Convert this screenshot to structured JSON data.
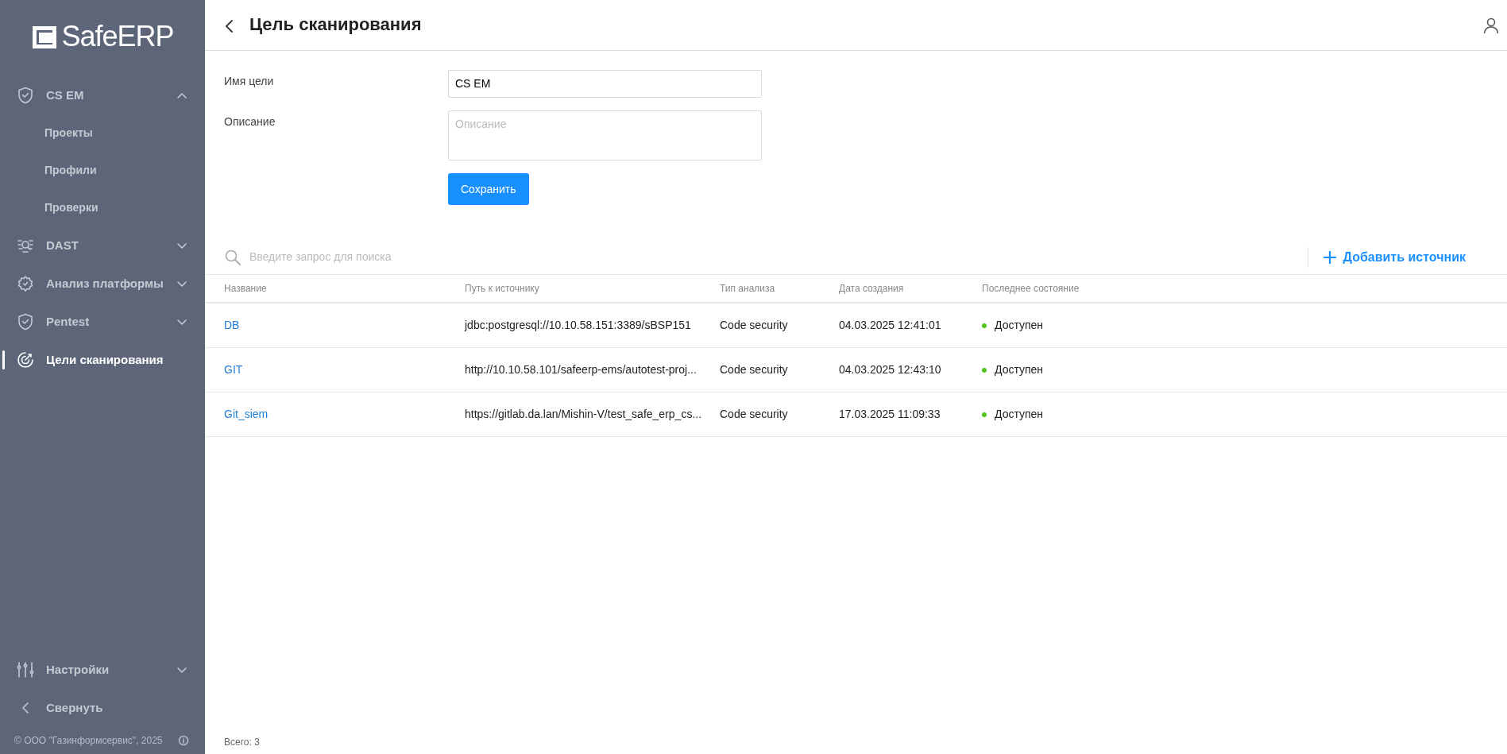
{
  "sidebar": {
    "logo": "Safe**ERP**",
    "items": [
      {
        "label": "CS EM",
        "expanded": true,
        "selected": false,
        "children": [
          {
            "label": "Проекты",
            "selected": false
          },
          {
            "label": "Профили",
            "selected": false
          },
          {
            "label": "Проверки",
            "selected": false
          }
        ]
      },
      {
        "label": "DAST",
        "expanded": false,
        "selected": false
      },
      {
        "label": "Анализ платформы",
        "expanded": false,
        "selected": false
      },
      {
        "label": "Pentest",
        "expanded": false,
        "selected": false
      },
      {
        "label": "Цели сканирования",
        "selected": true
      }
    ],
    "settings": {
      "label": "Настройки",
      "expanded": false
    },
    "collapse": "Свернуть",
    "copyright": "© ООО \"Газинформсервис\", 2025"
  },
  "header": {
    "title": "Цель сканирования"
  },
  "form": {
    "fields": [
      {
        "label": "Имя цели",
        "value": "CS EM",
        "kind": "input"
      },
      {
        "label": "Описание",
        "placeholder": "Описание",
        "kind": "textarea"
      }
    ],
    "save_button": "Сохранить"
  },
  "search": {
    "placeholder": "Введите запрос для поиска"
  },
  "add_button": "Добавить источник",
  "table": {
    "columns": [
      "Название",
      "Путь к источнику",
      "Тип анализа",
      "Дата создания",
      "Последнее состояние"
    ],
    "rows": [
      {
        "name": "DB",
        "path": "jdbc:postgresql://10.10.58.151:3389/sBSP151",
        "type": "Code security",
        "date": "04.03.2025 12:41:01",
        "status": "Доступен",
        "color": "#52c41a"
      },
      {
        "name": "GIT",
        "path": "http://10.10.58.101/safeerp-ems/autotest-proj...",
        "type": "Code security",
        "date": "04.03.2025 12:43:10",
        "status": "Доступен",
        "color": "#52c41a"
      },
      {
        "name": "Git_siem",
        "path": "https://gitlab.da.lan/Mishin-V/test_safe_erp_cs...",
        "type": "Code security",
        "date": "17.03.2025 11:09:33",
        "status": "Доступен",
        "color": "#52c41a"
      }
    ]
  },
  "total": "Всего: 3"
}
